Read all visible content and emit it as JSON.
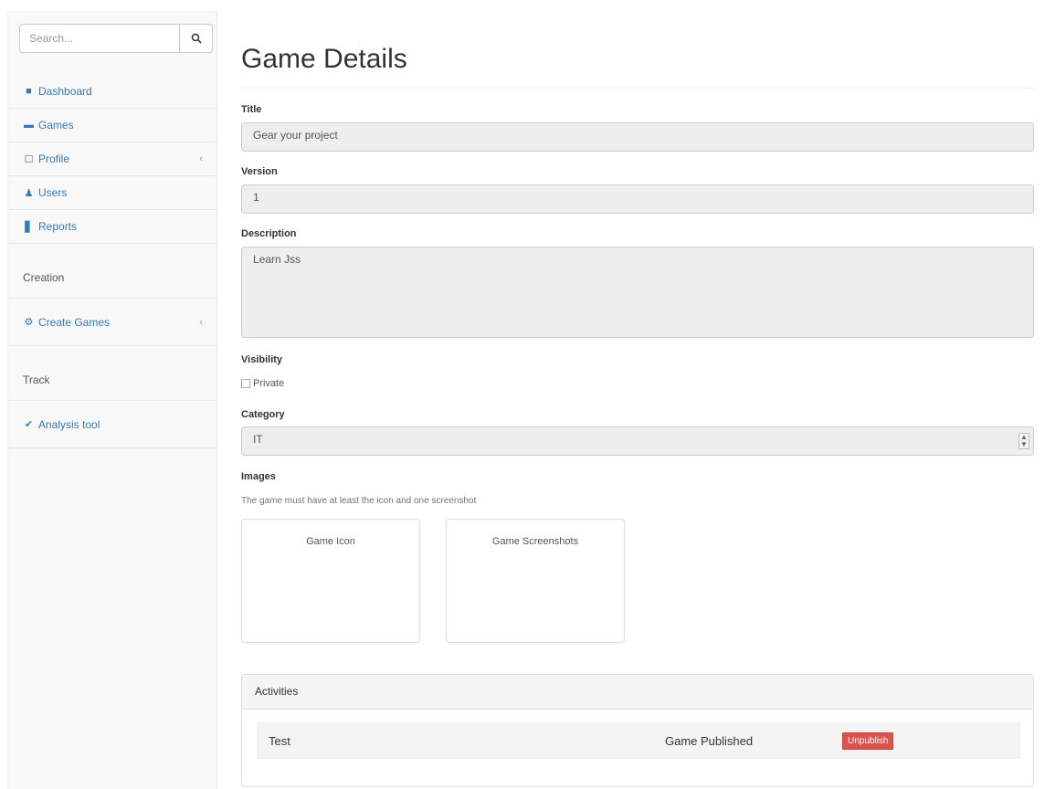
{
  "sidebar": {
    "search_placeholder": "Search...",
    "items": [
      {
        "label": "Dashboard",
        "icon": "dashboard-icon"
      },
      {
        "label": "Games",
        "icon": "games-icon"
      },
      {
        "label": "Profile",
        "icon": "profile-icon"
      },
      {
        "label": "Users",
        "icon": "user-icon"
      },
      {
        "label": "Reports",
        "icon": "bar-chart-icon"
      }
    ],
    "creation_header": "Creation",
    "creation_item": "Create Games",
    "track_header": "Track",
    "track_item": "Analysis tool"
  },
  "page": {
    "title": "Game Details"
  },
  "form": {
    "title_label": "Title",
    "title_value": "Gear your project",
    "version_label": "Version",
    "version_value": "1",
    "description_label": "Description",
    "description_value": "Learn Jss",
    "visibility_label": "Visibility",
    "private_label": "Private",
    "category_label": "Category",
    "category_value": "IT",
    "images_label": "Images",
    "images_help": "The game must have at least the icon and one screenshot",
    "icon_box_label": "Game Icon",
    "screenshots_box_label": "Game Screenshots"
  },
  "activities": {
    "heading": "Activities",
    "rows": [
      {
        "name": "Test",
        "status": "Game Published",
        "action": "Unpublish"
      }
    ]
  },
  "colors": {
    "link": "#337ab7",
    "danger": "#d9534f"
  }
}
